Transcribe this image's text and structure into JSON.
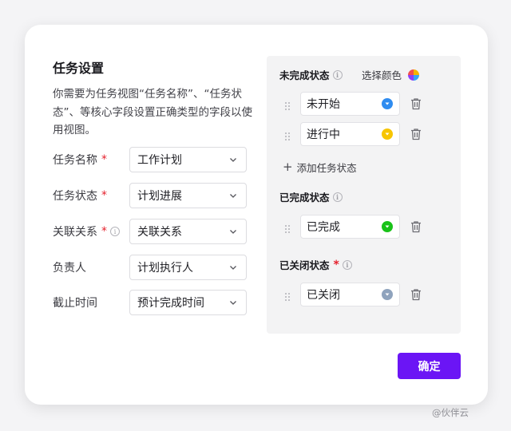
{
  "dialog": {
    "title": "任务设置",
    "description": "你需要为任务视图“任务名称”、“任务状态”、等核心字段设置正确类型的字段以使用视图。",
    "fields": [
      {
        "label": "任务名称",
        "required": true,
        "info": false,
        "value": "工作计划"
      },
      {
        "label": "任务状态",
        "required": true,
        "info": false,
        "value": "计划进展"
      },
      {
        "label": "关联关系",
        "required": true,
        "info": true,
        "value": "关联关系"
      },
      {
        "label": "负责人",
        "required": false,
        "info": false,
        "value": "计划执行人"
      },
      {
        "label": "截止时间",
        "required": false,
        "info": false,
        "value": "预计完成时间"
      }
    ],
    "required_mark": "*",
    "confirm_label": "确定"
  },
  "status_panel": {
    "pick_color_label": "选择颜色",
    "incomplete": {
      "heading": "未完成状态",
      "items": [
        {
          "label": "未开始",
          "color": "#2f8cf0"
        },
        {
          "label": "进行中",
          "color": "#f7c500"
        }
      ],
      "add_label": "添加任务状态"
    },
    "completed": {
      "heading": "已完成状态",
      "items": [
        {
          "label": "已完成",
          "color": "#19c219"
        }
      ]
    },
    "closed": {
      "heading": "已关闭状态",
      "items": [
        {
          "label": "已关闭",
          "color": "#8fa3bd"
        }
      ]
    }
  },
  "watermark": "@伙伴云",
  "icons": {
    "info": "info-icon",
    "chevron": "chevron-down-icon",
    "grip": "drag-handle-icon",
    "trash": "trash-icon",
    "palette": "color-palette-icon",
    "plus": "plus-icon"
  }
}
